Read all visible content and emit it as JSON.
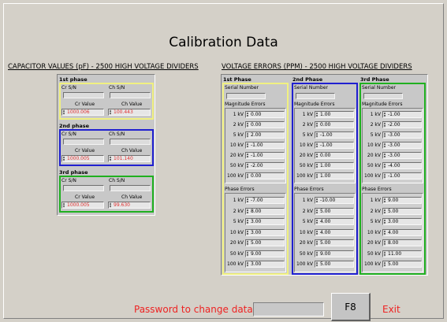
{
  "title": "Calibration Data",
  "capacitor": {
    "section_title": "CAPACITOR VALUES (pF) - 2500 HIGH VOLTAGE DIVIDERS",
    "phases": [
      {
        "title": "1st phase",
        "cr_sn_label": "Cr S/N",
        "ch_sn_label": "Ch S/N",
        "cr_value_label": "Cr Value",
        "ch_value_label": "Ch Value",
        "cr_value": "1000.006",
        "ch_value": "100.443",
        "frame_color": "#f0f080"
      },
      {
        "title": "2nd phase",
        "cr_sn_label": "Cr S/N",
        "ch_sn_label": "Ch S/N",
        "cr_value_label": "Cr Value",
        "ch_value_label": "Ch Value",
        "cr_value": "1000.005",
        "ch_value": "101.140",
        "frame_color": "#2020d0"
      },
      {
        "title": "3rd phase",
        "cr_sn_label": "Cr S/N",
        "ch_sn_label": "Ch S/N",
        "cr_value_label": "Cr Value",
        "ch_value_label": "Ch Value",
        "cr_value": "1000.005",
        "ch_value": "99.630",
        "frame_color": "#20b020"
      }
    ]
  },
  "voltage": {
    "section_title": "VOLTAGE ERRORS (PPM) - 2500 HIGH VOLTAGE DIVIDERS",
    "phases": [
      {
        "title": "1st Phase",
        "serial_label": "Serial Number",
        "magnitude_label": "Magnitude Errors",
        "phase_label": "Phase Errors",
        "frame_color": "#f0f080",
        "magnitude": [
          {
            "kv": "1 kV",
            "value": "0.00"
          },
          {
            "kv": "2 kV",
            "value": "0.00"
          },
          {
            "kv": "5 kV",
            "value": "2.00"
          },
          {
            "kv": "10 kV",
            "value": "-1.00"
          },
          {
            "kv": "20 kV",
            "value": "-1.00"
          },
          {
            "kv": "50 kV",
            "value": "-2.00"
          },
          {
            "kv": "100 kV",
            "value": "0.00"
          }
        ],
        "phase": [
          {
            "kv": "1 kV",
            "value": "-7.00"
          },
          {
            "kv": "2 kV",
            "value": "8.00"
          },
          {
            "kv": "5 kV",
            "value": "3.00"
          },
          {
            "kv": "10 kV",
            "value": "3.00"
          },
          {
            "kv": "20 kV",
            "value": "5.00"
          },
          {
            "kv": "50 kV",
            "value": "9.00"
          },
          {
            "kv": "100 kV",
            "value": "3.00"
          }
        ]
      },
      {
        "title": "2nd Phase",
        "serial_label": "Serial Number",
        "magnitude_label": "Magnitude Errors",
        "phase_label": "Phase Errors",
        "frame_color": "#2020d0",
        "magnitude": [
          {
            "kv": "1 kV",
            "value": "1.00"
          },
          {
            "kv": "2 kV",
            "value": "0.00"
          },
          {
            "kv": "5 kV",
            "value": "-1.00"
          },
          {
            "kv": "10 kV",
            "value": "-1.00"
          },
          {
            "kv": "20 kV",
            "value": "0.00"
          },
          {
            "kv": "50 kV",
            "value": "1.00"
          },
          {
            "kv": "100 kV",
            "value": "1.00"
          }
        ],
        "phase": [
          {
            "kv": "1 kV",
            "value": "-10.00"
          },
          {
            "kv": "2 kV",
            "value": "5.00"
          },
          {
            "kv": "5 kV",
            "value": "4.00"
          },
          {
            "kv": "10 kV",
            "value": "4.00"
          },
          {
            "kv": "20 kV",
            "value": "5.00"
          },
          {
            "kv": "50 kV",
            "value": "9.00"
          },
          {
            "kv": "100 kV",
            "value": "5.00"
          }
        ]
      },
      {
        "title": "3rd Phase",
        "serial_label": "Serial Number",
        "magnitude_label": "Magnitude Errors",
        "phase_label": "Phase Errors",
        "frame_color": "#20b020",
        "magnitude": [
          {
            "kv": "1 kV",
            "value": "-1.00"
          },
          {
            "kv": "2 kV",
            "value": "-2.00"
          },
          {
            "kv": "5 kV",
            "value": "-3.00"
          },
          {
            "kv": "10 kV",
            "value": "-3.00"
          },
          {
            "kv": "20 kV",
            "value": "-3.00"
          },
          {
            "kv": "50 kV",
            "value": "-4.00"
          },
          {
            "kv": "100 kV",
            "value": "-1.00"
          }
        ],
        "phase": [
          {
            "kv": "1 kV",
            "value": "9.00"
          },
          {
            "kv": "2 kV",
            "value": "5.00"
          },
          {
            "kv": "5 kV",
            "value": "3.00"
          },
          {
            "kv": "10 kV",
            "value": "4.00"
          },
          {
            "kv": "20 kV",
            "value": "8.00"
          },
          {
            "kv": "50 kV",
            "value": "11.00"
          },
          {
            "kv": "100 kV",
            "value": "5.00"
          }
        ]
      }
    ]
  },
  "footer": {
    "password_label": "Password to change data ->",
    "password_value": "",
    "f8_label": "F8",
    "exit_label": "Exit"
  },
  "colors": {
    "accent_red": "#ee2222",
    "value_red": "#e03030"
  }
}
